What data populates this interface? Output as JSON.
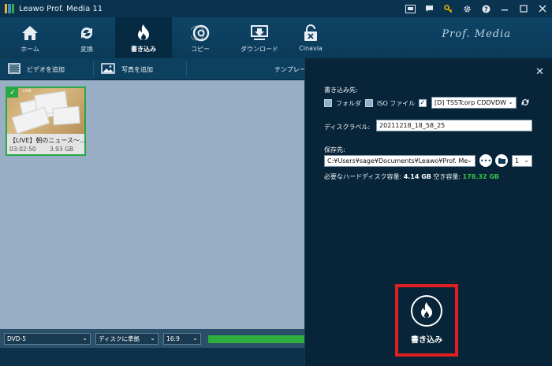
{
  "app": {
    "title": "Leawo Prof. Media 11",
    "brand": "Prof. Media",
    "logo_colors": [
      "#e9b123",
      "#2f8fd1",
      "#36a83c"
    ]
  },
  "titlebar_icons": [
    "cart-icon",
    "chat-icon",
    "key-icon",
    "gear-icon",
    "help-icon",
    "minimize-icon",
    "maximize-icon",
    "close-icon"
  ],
  "nav": [
    {
      "label": "ホーム",
      "icon": "home-icon",
      "active": false
    },
    {
      "label": "変換",
      "icon": "convert-icon",
      "active": false
    },
    {
      "label": "書き込み",
      "icon": "burn-icon",
      "active": true
    },
    {
      "label": "コピー",
      "icon": "disc-copy-icon",
      "active": false
    },
    {
      "label": "ダウンロード",
      "icon": "download-icon",
      "active": false
    },
    {
      "label": "Cinavia",
      "icon": "cinavia-icon",
      "active": false
    }
  ],
  "subbar": {
    "add_video": "ビデオを追加",
    "add_photo": "写真を追加",
    "template": "テンプレート"
  },
  "video_item": {
    "title": "【LIVE】朝のニュース〜…",
    "duration": "03:02:50",
    "size": "3.93 GB",
    "selected": true
  },
  "bottom": {
    "disc_type": "DVD-5",
    "fit_mode": "ディスクに準拠",
    "aspect": "16:9",
    "progress_pct": 100
  },
  "burn_panel": {
    "burn_to_label": "書き込み先:",
    "folder_label": "フォルダ",
    "folder_checked": false,
    "iso_label": "ISO ファイル",
    "iso_checked": false,
    "drive_checked": true,
    "drive_value": "[D] TSSTcorp CDDVDW",
    "disc_label_label": "ディスクラベル:",
    "disc_label_value": "20211218_18_58_25",
    "save_to_label": "保存先:",
    "save_path": "C:¥Users¥sage¥Documents¥Leawo¥Prof. Me",
    "copies": "1",
    "hdd_required_label": "必要なハードディスク容量:",
    "hdd_required_value": "4.14 GB",
    "free_space_label": "空き容量:",
    "free_space_value": "178.32 GB",
    "burn_button_label": "書き込み"
  },
  "colors": {
    "accent_green": "#27a845",
    "highlight_red": "#e02020",
    "free_space_green": "#39c24a"
  }
}
